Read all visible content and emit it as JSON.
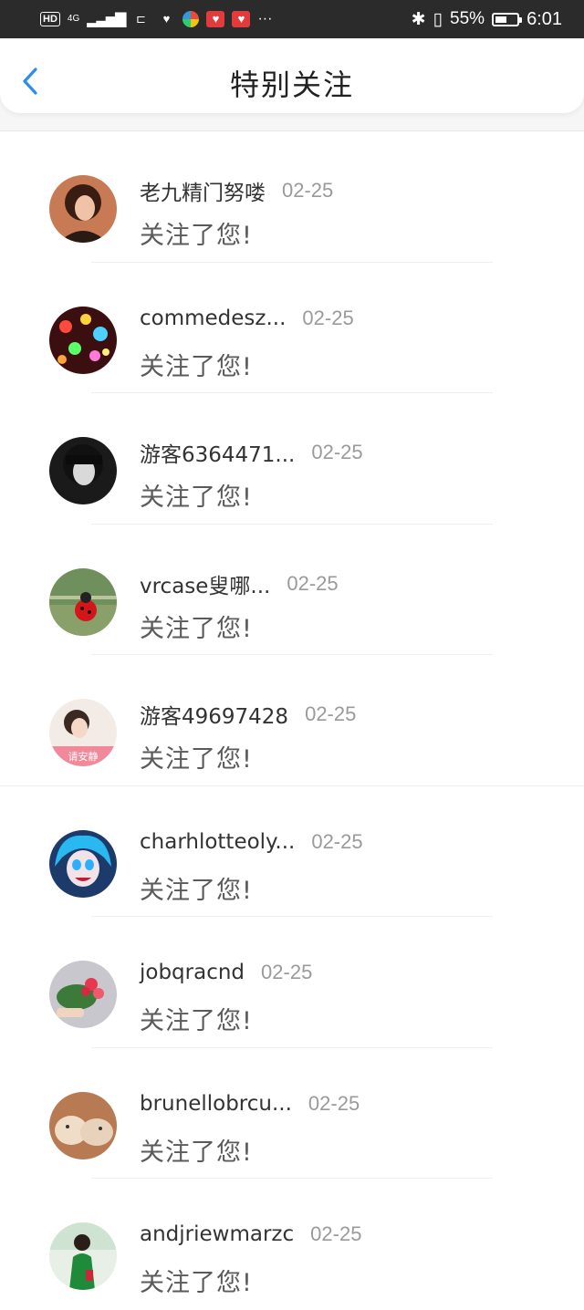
{
  "status_bar": {
    "hd": "HD",
    "network": "4G",
    "battery": "55%",
    "battery_level": 0.55,
    "time": "6:01",
    "more": "···"
  },
  "header": {
    "title": "特别关注"
  },
  "follows": [
    {
      "name": "老九精门努喽",
      "date": "02-25",
      "message": "关注了您!",
      "avatar": "avatar-woman-portrait"
    },
    {
      "name": "commedesz...",
      "date": "02-25",
      "message": "关注了您!",
      "avatar": "avatar-bokeh-lights"
    },
    {
      "name": "游客6364471...",
      "date": "02-25",
      "message": "关注了您!",
      "avatar": "avatar-bw-girl"
    },
    {
      "name": "vrcase叟哪...",
      "date": "02-25",
      "message": "关注了您!",
      "avatar": "avatar-ladybug-child"
    },
    {
      "name": "游客49697428",
      "date": "02-25",
      "message": "关注了您!",
      "avatar": "avatar-girl-label"
    },
    {
      "name": "charhlotteoly...",
      "date": "02-25",
      "message": "关注了您!",
      "avatar": "avatar-blue-hair-cartoon"
    },
    {
      "name": "jobqracnd",
      "date": "02-25",
      "message": "关注了您!",
      "avatar": "avatar-flower-bouquet"
    },
    {
      "name": "brunellobrcu...",
      "date": "02-25",
      "message": "关注了您!",
      "avatar": "avatar-cats"
    },
    {
      "name": "andjriewmarzc",
      "date": "02-25",
      "message": "关注了您!",
      "avatar": "avatar-girl-green"
    }
  ],
  "avatar_label_text": "请安静",
  "colors": {
    "status_bar_bg": "#2b2b2b",
    "accent_back": "#2d8cf0",
    "name_text": "#333333",
    "date_text": "#9a9a9a",
    "message_text": "#5a5a5a"
  }
}
